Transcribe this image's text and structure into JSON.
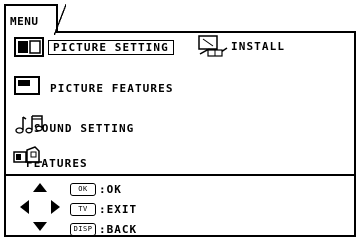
{
  "menu_tab": "MENU",
  "items": [
    {
      "label": "PICTURE SETTING",
      "icon": "picture-setting-icon",
      "selected": true
    },
    {
      "label": "INSTALL",
      "icon": "install-icon"
    },
    {
      "label": "PICTURE FEATURES",
      "icon": "picture-features-icon"
    },
    {
      "label": "SOUND SETTING",
      "icon": "sound-setting-icon"
    },
    {
      "label": "FEATURES",
      "icon": "features-icon"
    }
  ],
  "legend": {
    "dpad_icon": "dpad-arrows-icon",
    "rows": [
      {
        "key": "OK",
        "action": ":OK"
      },
      {
        "key": "TV",
        "action": ":EXIT"
      },
      {
        "key": "DISP",
        "action": ":BACK"
      }
    ]
  }
}
